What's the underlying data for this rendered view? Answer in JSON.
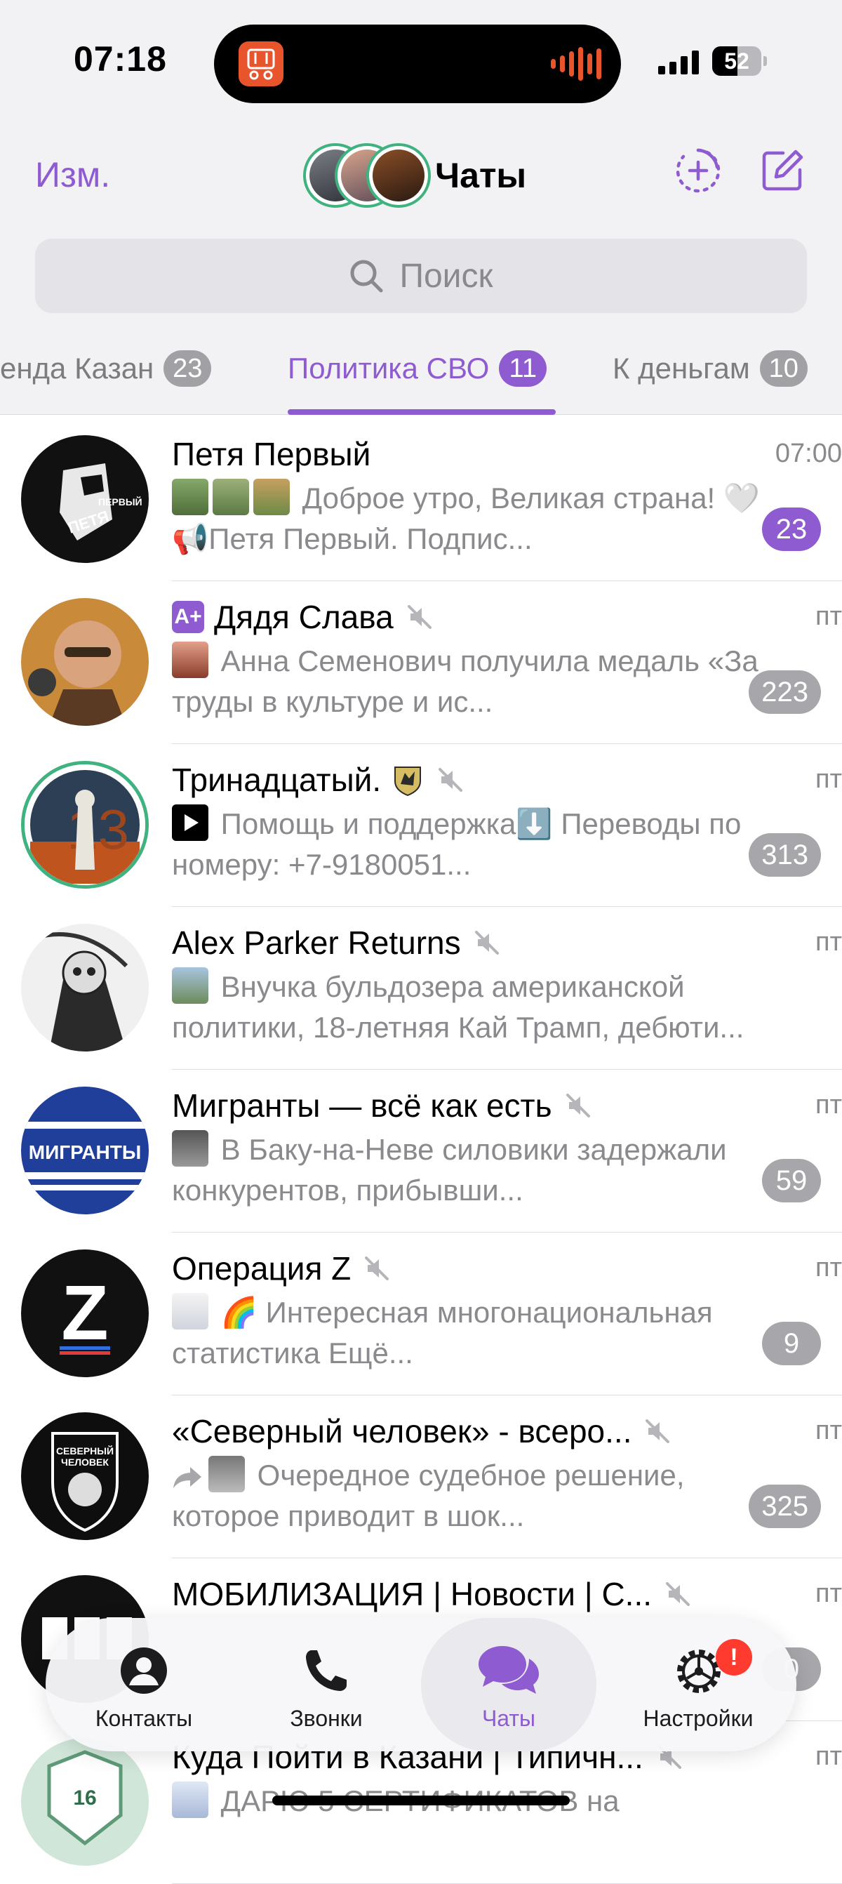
{
  "status_bar": {
    "time": "07:18",
    "battery": "52",
    "battery_level": 0.52
  },
  "header": {
    "edit_label": "Изм.",
    "title": "Чаты",
    "search_placeholder": "Поиск"
  },
  "folders": [
    {
      "label": "енда Казан",
      "count": "23",
      "active": false
    },
    {
      "label": "Политика СВО",
      "count": "11",
      "active": true
    },
    {
      "label": "К деньгам",
      "count": "10",
      "active": false
    }
  ],
  "chats": [
    {
      "name": "Петя Первый",
      "time": "07:00",
      "preview": "Доброе утро, Великая страна! 🤍 📢Петя Первый. Подпис...",
      "unread": "23",
      "muted": false
    },
    {
      "name": "Дядя Слава",
      "time": "пт",
      "preview": "Анна Семенович получила медаль «За труды в культуре и ис...",
      "unread": "223",
      "muted": true
    },
    {
      "name": "Тринадцатый.",
      "time": "пт",
      "preview": "Помощь и поддержка⬇️ Переводы по номеру: +7-9180051...",
      "unread": "313",
      "muted": true
    },
    {
      "name": "Alex Parker Returns",
      "time": "пт",
      "preview": "Внучка бульдозера американской политики, 18-летняя Кай Трамп, дебюти...",
      "unread": "",
      "muted": true
    },
    {
      "name": "Мигранты — всё как есть",
      "time": "пт",
      "preview": "В Баку-на-Неве силовики задержали конкурентов, прибывши...",
      "unread": "59",
      "muted": true
    },
    {
      "name": "Операция Z",
      "time": "пт",
      "preview": "🌈 Интересная многонациональная статистика Ещё...",
      "unread": "9",
      "muted": true
    },
    {
      "name": "«Северный человек» - всеро...",
      "time": "пт",
      "preview": "Очередное судебное решение, которое приводит в шок...",
      "unread": "325",
      "muted": true
    },
    {
      "name": "МОБИЛИЗАЦИЯ | Новости | С...",
      "time": "пт",
      "preview": "",
      "unread": "0",
      "muted": true
    },
    {
      "name": "Куда Пойти в Казани | Типичн...",
      "time": "пт",
      "preview": "ДАРЮ 5 СЕРТИФИКАТОВ на",
      "unread": "",
      "muted": true
    }
  ],
  "avatar_texts": {
    "petya": "ПЕТЯ",
    "petya_tag": "ПЕРВЫЙ",
    "migranty": "МИГРАНТЫ",
    "north1": "СЕВЕРНЫЙ",
    "north2": "ЧЕЛОВЕК",
    "z": "Z",
    "trinadtsat": "13",
    "kazan": "16"
  },
  "tabbar": {
    "contacts": "Контакты",
    "calls": "Звонки",
    "chats": "Чаты",
    "settings": "Настройки",
    "settings_badge": "!"
  },
  "colors": {
    "accent": "#8e5bd0",
    "muted_badge": "#a6a6ab",
    "alert": "#ff3b30",
    "story_ring": "#3fb27f"
  }
}
